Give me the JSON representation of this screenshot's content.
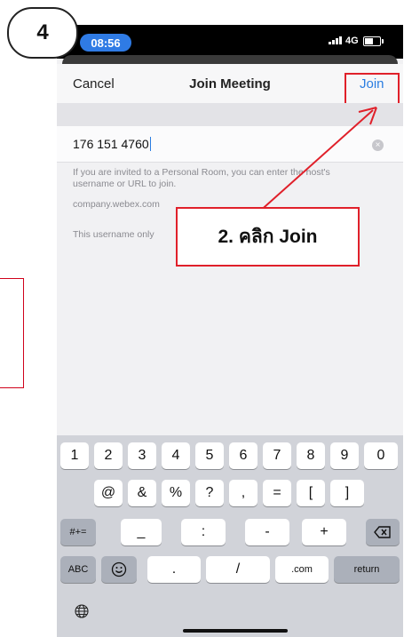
{
  "step_badge": "4",
  "status_bar": {
    "time": "08:56",
    "network": "4G"
  },
  "nav": {
    "cancel": "Cancel",
    "title": "Join Meeting",
    "join": "Join"
  },
  "input": {
    "value": "176 151 4760"
  },
  "help": {
    "line1": "If you are invited to a Personal Room, you can enter the host's username or URL to join.",
    "line2": "company.webex.com",
    "line3": "This username only"
  },
  "callout": "2. คลิก Join",
  "keyboard": {
    "row1": [
      "1",
      "2",
      "3",
      "4",
      "5",
      "6",
      "7",
      "8",
      "9",
      "0"
    ],
    "row2": [
      "@",
      "&",
      "%",
      "?",
      ",",
      "=",
      "[",
      "]"
    ],
    "row3_switch": "#+=",
    "row3": [
      "_",
      ":",
      "-",
      "+"
    ],
    "row4": {
      "abc": "ABC",
      "dot": ".",
      "slash": "/",
      "com": ".com",
      "return": "return"
    }
  },
  "colors": {
    "accent": "#2a7de1",
    "highlight": "#e0202a"
  }
}
